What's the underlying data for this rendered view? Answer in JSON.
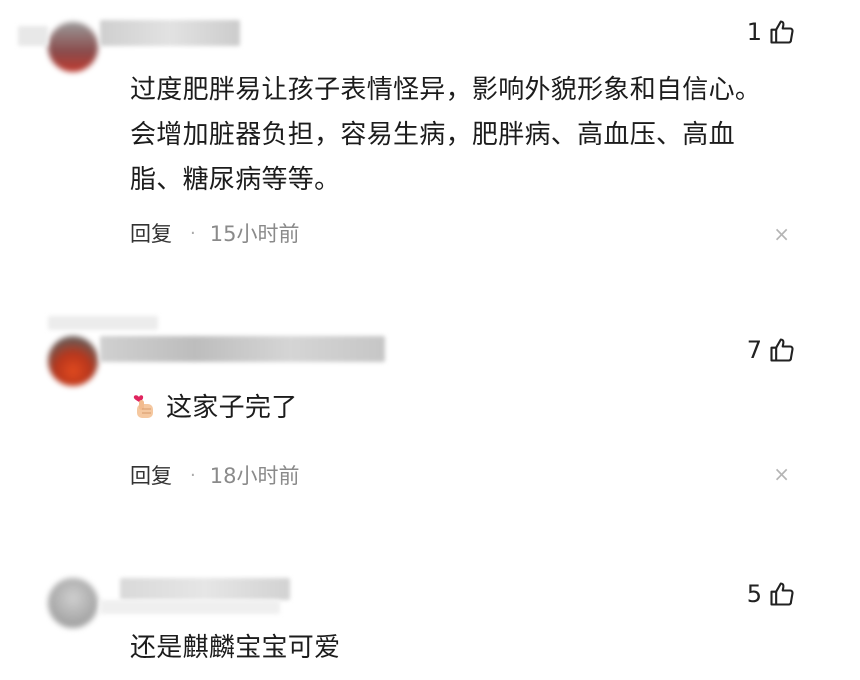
{
  "comments": [
    {
      "likes": "1",
      "text": "过度肥胖易让孩子表情怪异，影响外貌形象和自信心。会增加脏器负担，容易生病，肥胖病、高血压、高血脂、糖尿病等等。",
      "reply_label": "回复",
      "separator": "·",
      "time": "15小时前",
      "close_glyph": "×",
      "icons": {
        "like": "thumbs-up-icon",
        "close": "close-icon"
      }
    },
    {
      "likes": "7",
      "emoji": "finger-heart-emoji",
      "text": "这家子完了",
      "reply_label": "回复",
      "separator": "·",
      "time": "18小时前",
      "close_glyph": "×",
      "icons": {
        "like": "thumbs-up-icon",
        "close": "close-icon"
      }
    },
    {
      "likes": "5",
      "text": "还是麒麟宝宝可爱",
      "icons": {
        "like": "thumbs-up-icon"
      }
    }
  ]
}
